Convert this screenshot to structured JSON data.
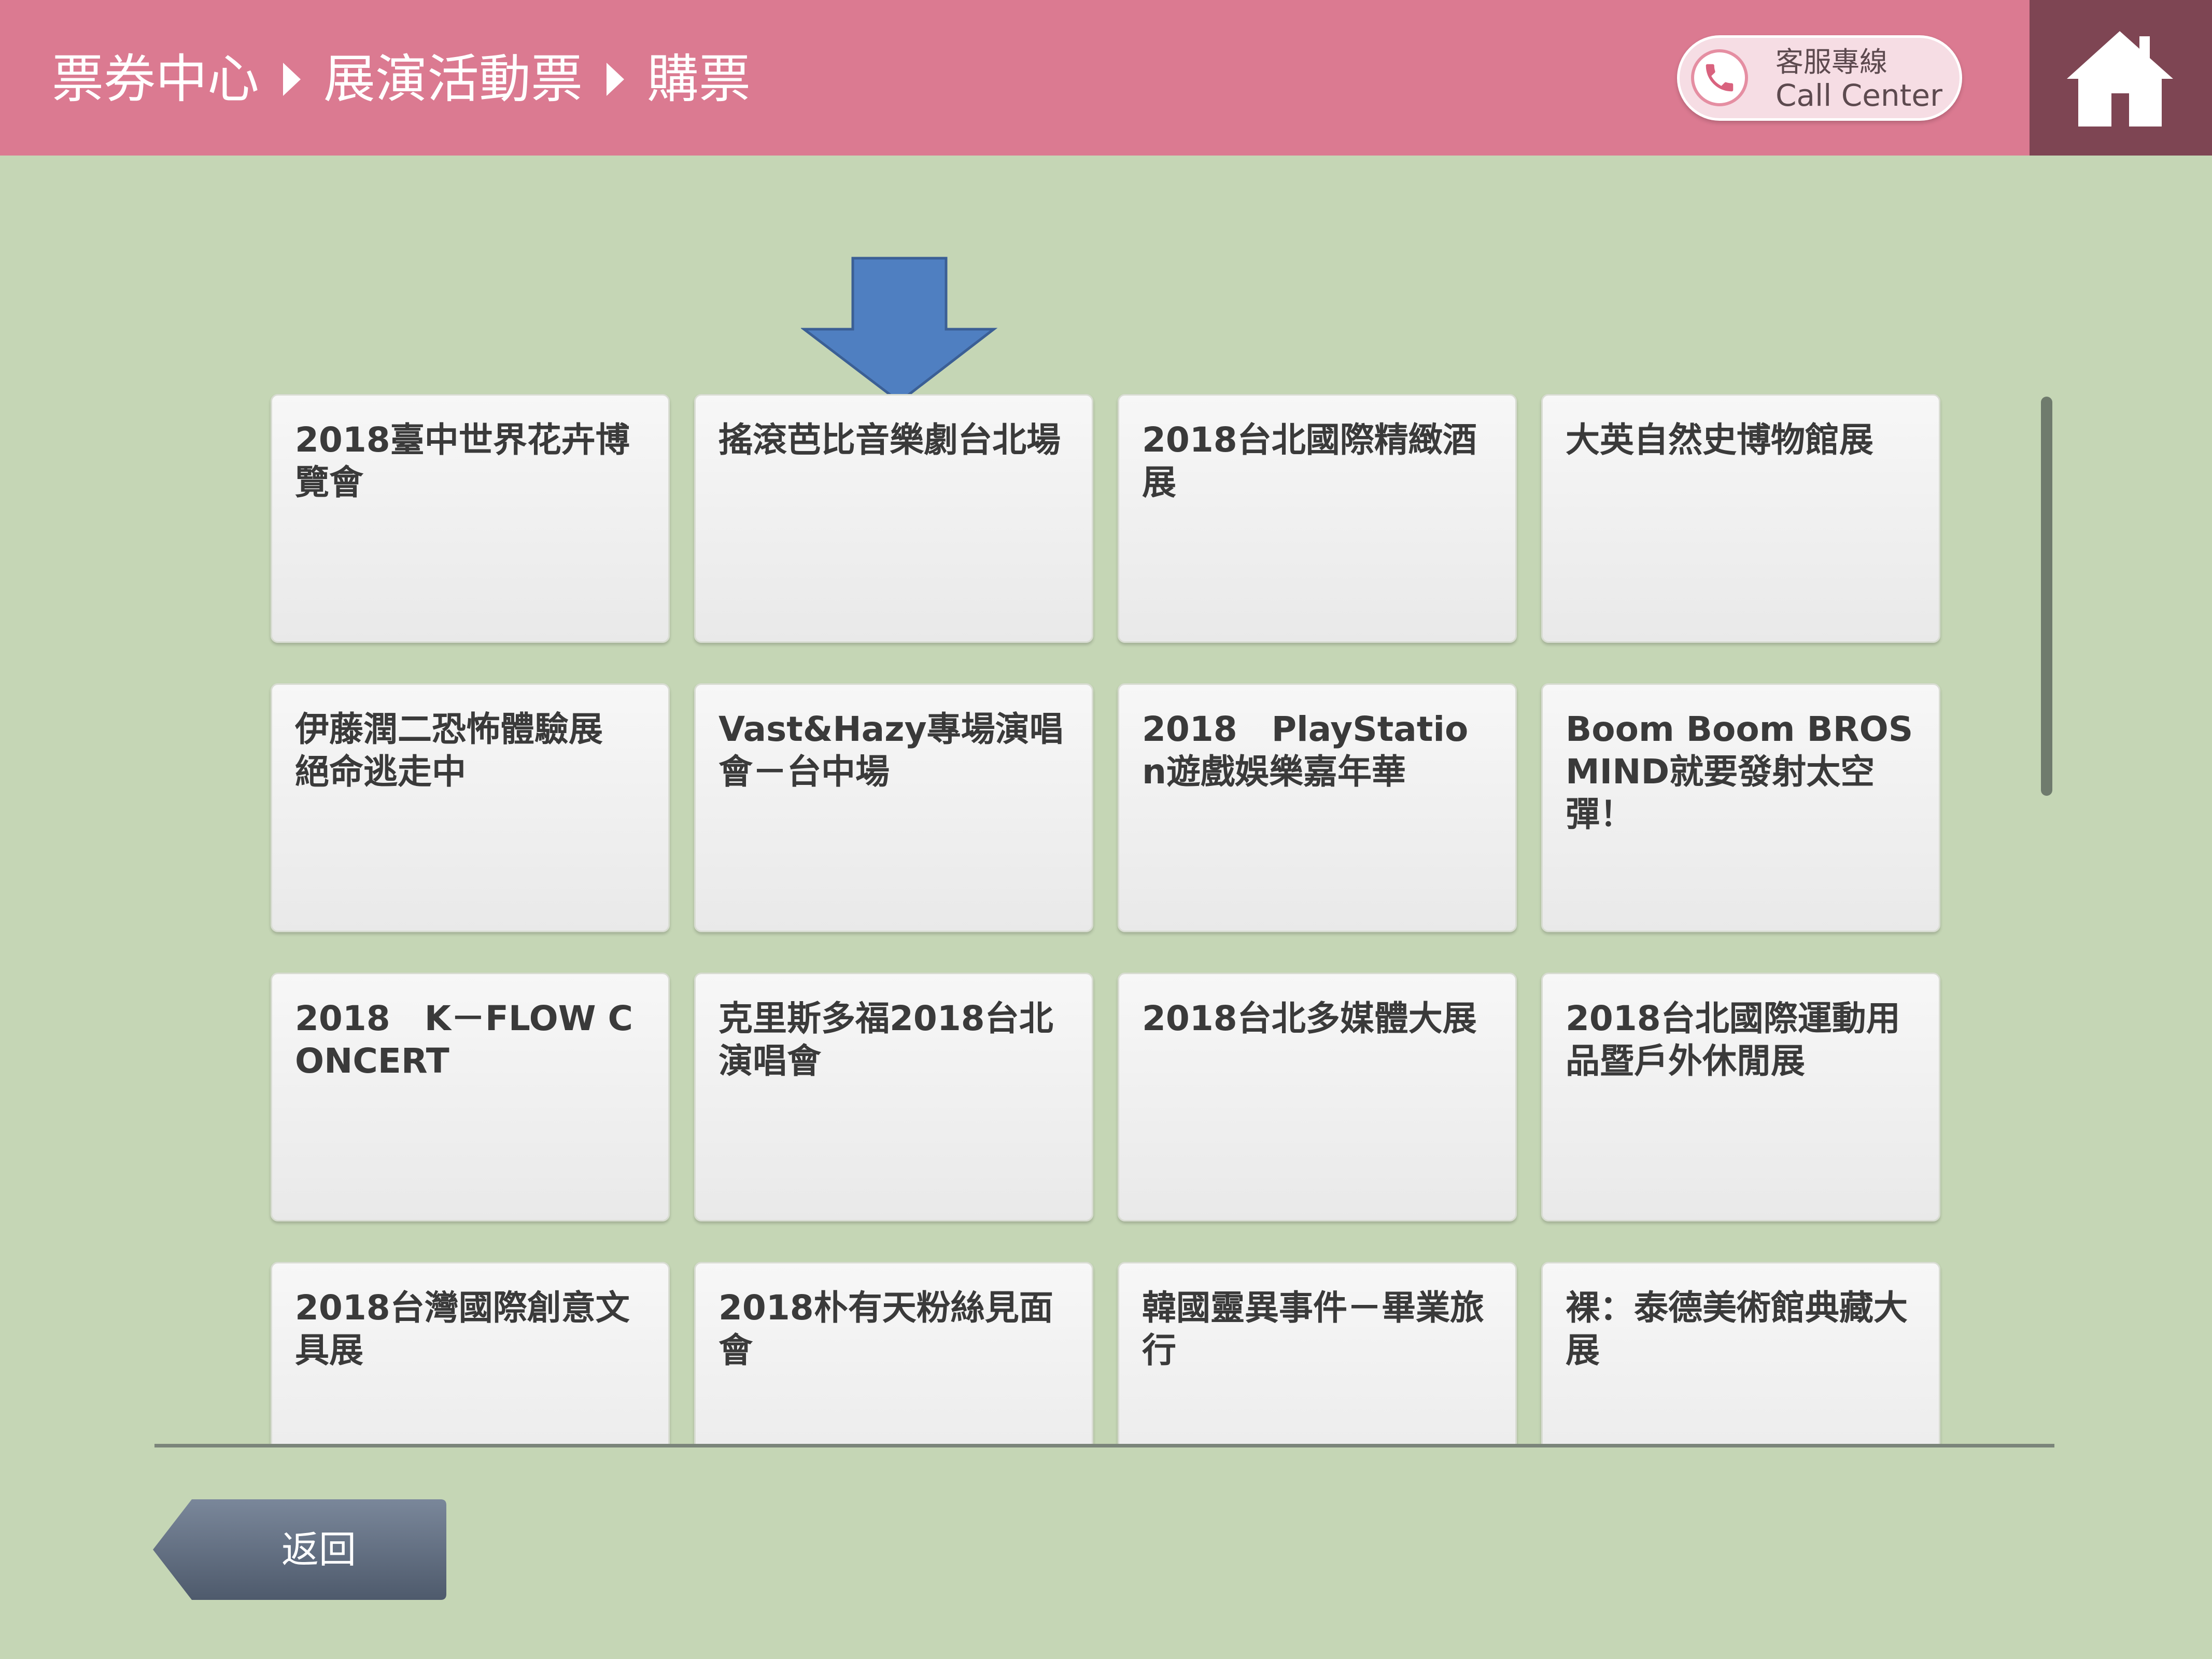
{
  "header": {
    "breadcrumb": [
      "票券中心",
      "展演活動票",
      "購票"
    ],
    "call_center_zh": "客服專線",
    "call_center_en": "Call Center"
  },
  "events": [
    {
      "title": "2018臺中世界花卉博覽會"
    },
    {
      "title": "搖滾芭比音樂劇台北場"
    },
    {
      "title": "2018台北國際精緻酒展"
    },
    {
      "title": "大英自然史博物館展"
    },
    {
      "title": "伊藤潤二恐怖體驗展 絕命逃走中"
    },
    {
      "title": "Vast&Hazy專場演唱會－台中場"
    },
    {
      "title": "2018　PlayStation遊戲娛樂嘉年華"
    },
    {
      "title": "Boom Boom BROSMIND就要發射太空彈！"
    },
    {
      "title": "2018　K－FLOW CONCERT"
    },
    {
      "title": "克里斯多福2018台北演唱會"
    },
    {
      "title": "2018台北多媒體大展"
    },
    {
      "title": "2018台北國際運動用品暨戶外休閒展"
    },
    {
      "title": "2018台灣國際創意文具展"
    },
    {
      "title": "2018朴有天粉絲見面會"
    },
    {
      "title": "韓國靈異事件－畢業旅行"
    },
    {
      "title": "裸：泰德美術館典藏大展"
    }
  ],
  "footer": {
    "back_label": "返回"
  },
  "colors": {
    "header_bg": "#db7a91",
    "home_bg": "#7e4553",
    "page_bg": "#c5d6b5",
    "arrow": "#4f7fc1",
    "back_button": "#5d6b7e"
  },
  "icons": {
    "phone": "phone-icon",
    "home": "home-icon",
    "pointer": "arrow-down-icon"
  }
}
